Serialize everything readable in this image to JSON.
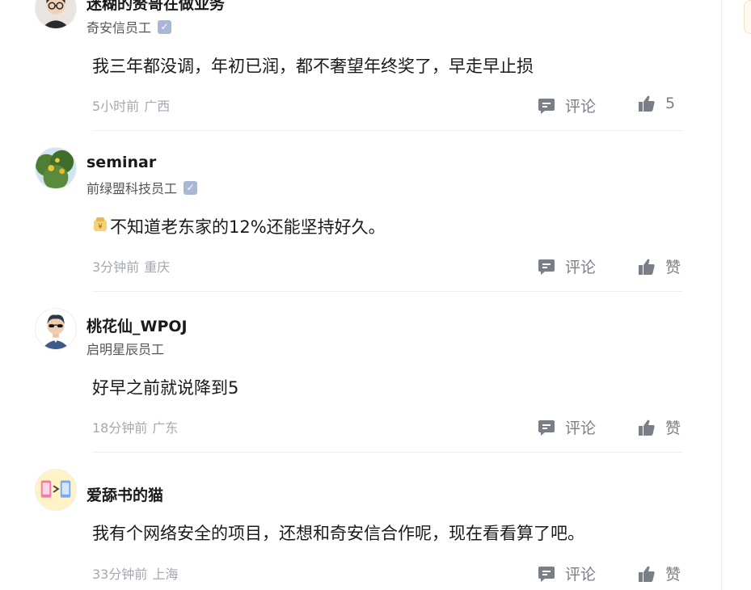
{
  "comments": [
    {
      "name": "迷糊的赘哥在做业务",
      "company": "奇安信员工",
      "verified": true,
      "text": "我三年都没调，年初已润，都不奢望年终奖了，早走早止损",
      "time": "5小时前",
      "location": "广西",
      "comment_label": "评论",
      "like_label": "5",
      "avatar_icon": "glasses-man-avatar-icon"
    },
    {
      "name": "seminar",
      "company": "前绿盟科技员工",
      "verified": true,
      "emoji": "money-bag-emoji-icon",
      "text": "不知道老东家的12%还能坚持好久。",
      "time": "3分钟前",
      "location": "重庆",
      "comment_label": "评论",
      "like_label": "赞",
      "avatar_icon": "citrus-tree-avatar-icon"
    },
    {
      "name": "桃花仙_WPOJ",
      "company": "启明星辰员工",
      "verified": false,
      "text": "好早之前就说降到5",
      "time": "18分钟前",
      "location": "广东",
      "comment_label": "评论",
      "like_label": "赞",
      "avatar_icon": "sunglasses-man-avatar-icon"
    },
    {
      "name": "爱舔书的猫",
      "company": "",
      "verified": false,
      "text": "我有个网络安全的项目，还想和奇安信合作呢，现在看看算了吧。",
      "time": "33分钟前",
      "location": "上海",
      "comment_label": "评论",
      "like_label": "赞",
      "avatar_icon": "phones-avatar-icon"
    }
  ],
  "colors": {
    "name": "#1a1a1a",
    "meta": "#a4a8b0",
    "action": "#7a7e86",
    "verified_badge": "#a9b7d6"
  }
}
